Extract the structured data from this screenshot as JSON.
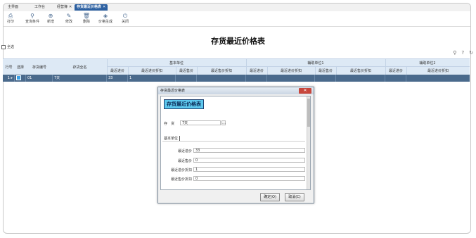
{
  "tabs": [
    {
      "label": "主界面"
    },
    {
      "label": "工作台"
    },
    {
      "label": "经营簿"
    },
    {
      "label": "存货最近价格表",
      "active": true
    }
  ],
  "toolbar": [
    {
      "icon": "printer-icon",
      "glyph": "⎙",
      "label": "打印"
    },
    {
      "icon": "search-icon",
      "glyph": "⚲",
      "label": "查询条件"
    },
    {
      "icon": "add-circle-icon",
      "glyph": "⊕",
      "label": "新增"
    },
    {
      "icon": "edit-icon",
      "glyph": "✎",
      "label": "修改"
    },
    {
      "icon": "trash-icon",
      "glyph": "🗑",
      "label": "删除"
    },
    {
      "icon": "tag-icon",
      "glyph": "◈",
      "label": "价格生成"
    },
    {
      "icon": "power-icon",
      "glyph": "⏻",
      "label": "关闭"
    }
  ],
  "page_title": "存货最近价格表",
  "select_all_label": "全选",
  "grid": {
    "fixed_headers": [
      "行号",
      "选择",
      "存货编号",
      "存货全名"
    ],
    "groups": [
      "基本单位",
      "辅助单位1",
      "辅助单位2"
    ],
    "sub_headers": [
      "最近进价",
      "最近进价折扣",
      "最近售价",
      "最近售价折扣"
    ],
    "sub_headers_group3": [
      "最近进价",
      "最近进价折扣"
    ],
    "row": {
      "row_no": "1",
      "code": "01",
      "name": "7天",
      "recent_purchase_price": "33",
      "recent_purchase_discount": "1"
    }
  },
  "dialog": {
    "title": "存货最近价格表",
    "close_label": "✕",
    "header": "存货最近价格表",
    "goods_label": "存　货",
    "goods_value": "7天",
    "tab_label": "基本单位",
    "fields": [
      {
        "label": "最近进价",
        "value": "33"
      },
      {
        "label": "最近售价",
        "value": "0"
      },
      {
        "label": "最近进价折扣",
        "value": "1"
      },
      {
        "label": "最近售价折扣",
        "value": "0"
      }
    ],
    "ok_label": "确定(O)",
    "cancel_label": "取消(C)"
  }
}
